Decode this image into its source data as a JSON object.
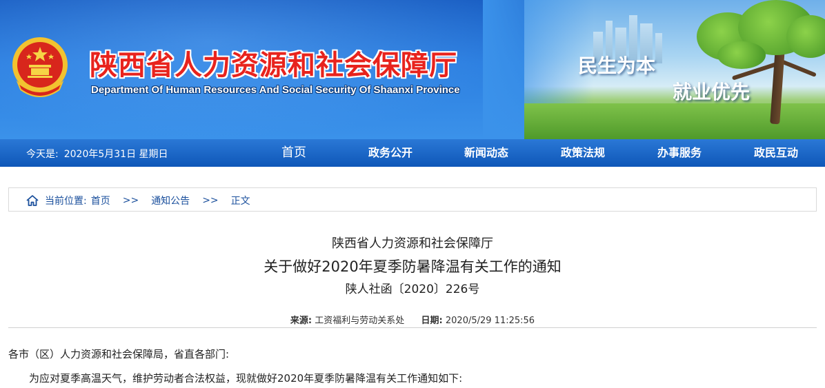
{
  "header": {
    "title_cn": "陕西省人力资源和社会保障厅",
    "title_en": "Department Of Human Resources And Social Security Of Shaanxi Province",
    "slogan_1": "民生为本",
    "slogan_2": "就业优先",
    "emblem_icon": "national-emblem-icon"
  },
  "nav": {
    "today_label": "今天是:",
    "today_date": "2020年5月31日 星期日",
    "items": [
      {
        "label": "首页"
      },
      {
        "label": "政务公开"
      },
      {
        "label": "新闻动态"
      },
      {
        "label": "政策法规"
      },
      {
        "label": "办事服务"
      },
      {
        "label": "政民互动"
      }
    ]
  },
  "breadcrumb": {
    "prefix": "当前位置:",
    "home": "首页",
    "separator": ">>",
    "section": "通知公告",
    "current": "正文",
    "icon": "home-icon"
  },
  "article": {
    "issuer": "陕西省人力资源和社会保障厅",
    "title": "关于做好2020年夏季防暑降温有关工作的通知",
    "doc_number": "陕人社函〔2020〕226号",
    "source_label": "来源:",
    "source": "工资福利与劳动关系处",
    "date_label": "日期:",
    "date": "2020/5/29 11:25:56",
    "paragraphs": [
      "各市（区）人力资源和社会保障局，省直各部门:",
      "为应对夏季高温天气，维护劳动者合法权益，现就做好2020年夏季防暑降温有关工作通知如下:"
    ]
  },
  "colors": {
    "banner_blue": "#2b7ee0",
    "nav_blue": "#0f57b8",
    "title_red": "#e8231d",
    "link_blue": "#1a4f9c"
  }
}
